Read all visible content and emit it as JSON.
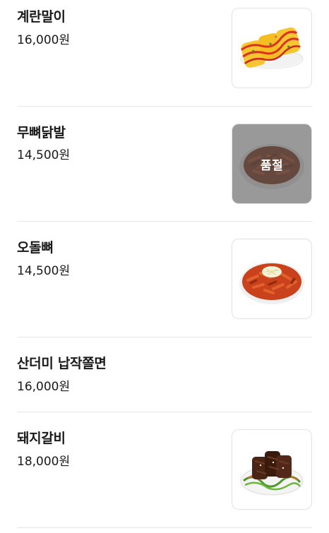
{
  "menu": {
    "items": [
      {
        "name": "계란말이",
        "price": "16,000원",
        "image": "rolled-omelette-photo"
      },
      {
        "name": "무뼈닭발",
        "price": "14,500원",
        "image": "boneless-chicken-feet-photo",
        "badge": "품절"
      },
      {
        "name": "오돌뼈",
        "price": "14,500원",
        "image": "spicy-pork-cartilage-photo"
      },
      {
        "name": "산더미 납작쫄면",
        "price": "16,000원"
      },
      {
        "name": "돼지갈비",
        "price": "18,000원",
        "image": "pork-galbi-photo"
      }
    ]
  },
  "colors": {
    "divider": "#e6e6e6",
    "text": "#1a1a1a",
    "soldout_overlay": "#5a5a5a"
  }
}
